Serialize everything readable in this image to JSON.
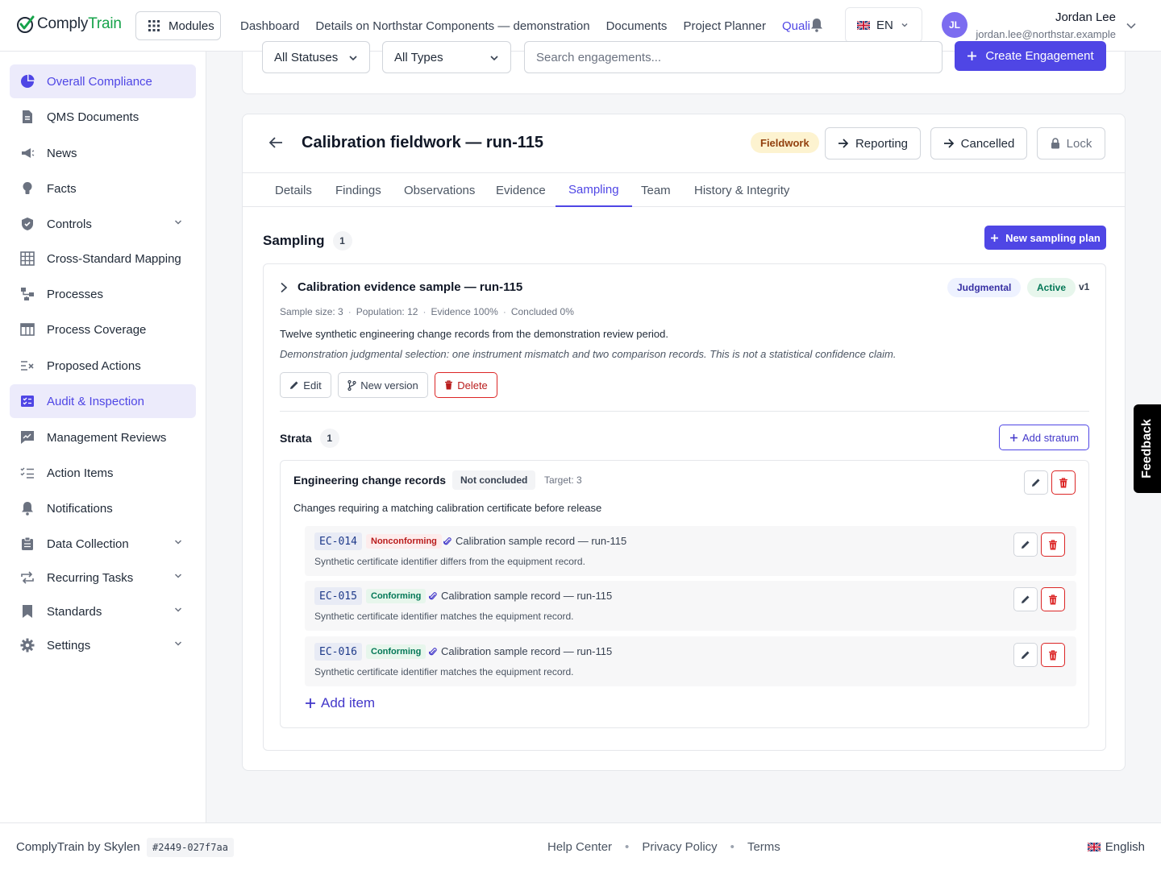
{
  "app": {
    "logo_prefix": "Comply",
    "logo_suffix": "Train",
    "modules_label": "Modules"
  },
  "topnav": {
    "items": [
      "Dashboard",
      "Details on Northstar Components — demonstration",
      "Documents",
      "Project Planner",
      "Quali"
    ],
    "active_index": 4
  },
  "language": {
    "code": "EN",
    "flag": "uk-flag"
  },
  "user": {
    "initials": "JL",
    "name": "Jordan Lee",
    "email": "jordan.lee@northstar.example"
  },
  "sidebar": {
    "items": [
      {
        "label": "Overall Compliance",
        "icon": "pie-chart-icon",
        "active": true,
        "expandable": false
      },
      {
        "label": "QMS Documents",
        "icon": "document-icon",
        "active": false,
        "expandable": false
      },
      {
        "label": "News",
        "icon": "megaphone-icon",
        "active": false,
        "expandable": false
      },
      {
        "label": "Facts",
        "icon": "lightbulb-icon",
        "active": false,
        "expandable": false
      },
      {
        "label": "Controls",
        "icon": "shield-check-icon",
        "active": false,
        "expandable": true
      },
      {
        "label": "Cross-Standard Mapping",
        "icon": "grid-icon",
        "active": false,
        "expandable": false
      },
      {
        "label": "Processes",
        "icon": "flow-icon",
        "active": false,
        "expandable": false
      },
      {
        "label": "Process Coverage",
        "icon": "table-icon",
        "active": false,
        "expandable": false
      },
      {
        "label": "Proposed Actions",
        "icon": "list-x-icon",
        "active": false,
        "expandable": false
      },
      {
        "label": "Audit & Inspection",
        "icon": "checklist-icon",
        "active": true,
        "expandable": false
      },
      {
        "label": "Management Reviews",
        "icon": "chat-chart-icon",
        "active": false,
        "expandable": false
      },
      {
        "label": "Action Items",
        "icon": "list-check-icon",
        "active": false,
        "expandable": false
      },
      {
        "label": "Notifications",
        "icon": "bell-icon",
        "active": false,
        "expandable": false
      },
      {
        "label": "Data Collection",
        "icon": "clipboard-icon",
        "active": false,
        "expandable": true
      },
      {
        "label": "Recurring Tasks",
        "icon": "repeat-icon",
        "active": false,
        "expandable": true
      },
      {
        "label": "Standards",
        "icon": "bookmark-icon",
        "active": false,
        "expandable": true
      },
      {
        "label": "Settings",
        "icon": "gear-icon",
        "active": false,
        "expandable": true
      }
    ]
  },
  "filters": {
    "status": "All Statuses",
    "type": "All Types",
    "search_placeholder": "Search engagements...",
    "create_label": "Create Engagement"
  },
  "engagement": {
    "title": "Calibration fieldwork — run-115",
    "phase": "Fieldwork",
    "actions": {
      "reporting": "Reporting",
      "cancelled": "Cancelled",
      "lock": "Lock"
    },
    "tabs": [
      "Details",
      "Findings",
      "Observations",
      "Evidence",
      "Sampling",
      "Team",
      "History & Integrity"
    ],
    "active_tab": "Sampling"
  },
  "sampling": {
    "title": "Sampling",
    "count": "1",
    "new_plan_label": "New sampling plan",
    "plan": {
      "title": "Calibration evidence sample — run-115",
      "method": "Judgmental",
      "state": "Active",
      "version": "v1",
      "meta": [
        "Sample size: 3",
        "Population: 12",
        "Evidence 100%",
        "Concluded 0%"
      ],
      "description": "Twelve synthetic engineering change records from the demonstration review period.",
      "note": "Demonstration judgmental selection: one instrument mismatch and two comparison records. This is not a statistical confidence claim.",
      "buttons": {
        "edit": "Edit",
        "new_version": "New version",
        "delete": "Delete"
      }
    },
    "strata": {
      "title": "Strata",
      "count": "1",
      "add_label": "Add stratum",
      "stratum": {
        "name": "Engineering change records",
        "status": "Not concluded",
        "target": "Target: 3",
        "description": "Changes requiring a matching calibration certificate before release",
        "items": [
          {
            "code": "EC-014",
            "result": "Nonconforming",
            "record": "Calibration sample record — run-115",
            "note": "Synthetic certificate identifier differs from the equipment record."
          },
          {
            "code": "EC-015",
            "result": "Conforming",
            "record": "Calibration sample record — run-115",
            "note": "Synthetic certificate identifier matches the equipment record."
          },
          {
            "code": "EC-016",
            "result": "Conforming",
            "record": "Calibration sample record — run-115",
            "note": "Synthetic certificate identifier matches the equipment record."
          }
        ],
        "add_item_label": "Add item"
      }
    }
  },
  "feedback_label": "Feedback",
  "footer": {
    "brand": "ComplyTrain by Skylen",
    "build": "#2449-027f7aa",
    "links": [
      "Help Center",
      "Privacy Policy",
      "Terms"
    ],
    "language": "English"
  },
  "colors": {
    "accent": "#4f46e5",
    "brand_green": "#16a34a",
    "danger": "#dc2626",
    "fieldwork_bg": "#fdf3d0"
  }
}
